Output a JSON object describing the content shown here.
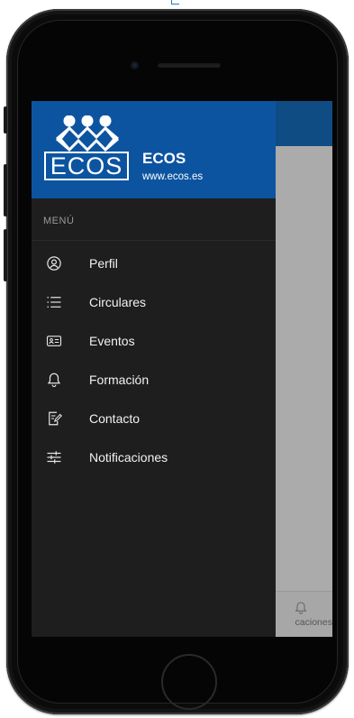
{
  "drawer": {
    "logo_text": "ECOS",
    "brand_title": "ECOS",
    "brand_url": "www.ecos.es",
    "menu_heading": "MENÚ",
    "items": [
      {
        "label": "Perfil",
        "icon": "user-circle-icon"
      },
      {
        "label": "Circulares",
        "icon": "list-icon"
      },
      {
        "label": "Eventos",
        "icon": "id-card-icon"
      },
      {
        "label": "Formación",
        "icon": "bell-icon"
      },
      {
        "label": "Contacto",
        "icon": "edit-document-icon"
      },
      {
        "label": "Notificaciones",
        "icon": "sliders-icon"
      }
    ]
  },
  "bottom_nav": {
    "partial_tab_label": "caciones",
    "partial_tab_icon": "bell-icon"
  },
  "colors": {
    "drawer_header": "#0d54a0",
    "drawer_body": "#1e1e1e",
    "app_header": "#0f4c84",
    "overlay": "#ababab"
  }
}
